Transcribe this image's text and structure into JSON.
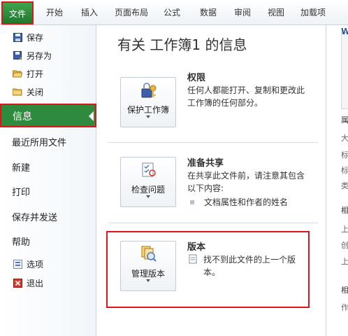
{
  "ribbon": {
    "file_label": "文件",
    "tabs": [
      "开始",
      "插入",
      "页面布局",
      "公式",
      "数据",
      "审阅",
      "视图",
      "加载项"
    ]
  },
  "sidebar": {
    "save": "保存",
    "save_as": "另存为",
    "open": "打开",
    "close": "关闭",
    "info": "信息",
    "recent": "最近所用文件",
    "new": "新建",
    "print": "打印",
    "save_send": "保存并发送",
    "help": "帮助",
    "options": "选项",
    "exit": "退出"
  },
  "main": {
    "title": "有关 工作簿1 的信息",
    "permissions": {
      "button": "保护工作簿",
      "heading": "权限",
      "text": "任何人都能打开、复制和更改此工作簿的任何部分。"
    },
    "prepare": {
      "button": "检查问题",
      "heading": "准备共享",
      "text": "在共享此文件前，请注意其包含以下内容:",
      "bullet": "文档属性和作者的姓名"
    },
    "versions": {
      "button": "管理版本",
      "heading": "版本",
      "text": "找不到此文件的上一个版本。"
    }
  },
  "right_panel": {
    "chars": [
      "W",
      "属",
      "大",
      "标",
      "标",
      "类",
      "相",
      "上",
      "创",
      "上",
      "相",
      "作"
    ]
  },
  "colors": {
    "accent_green": "#2e8b3d",
    "highlight_red": "#e0141b"
  }
}
